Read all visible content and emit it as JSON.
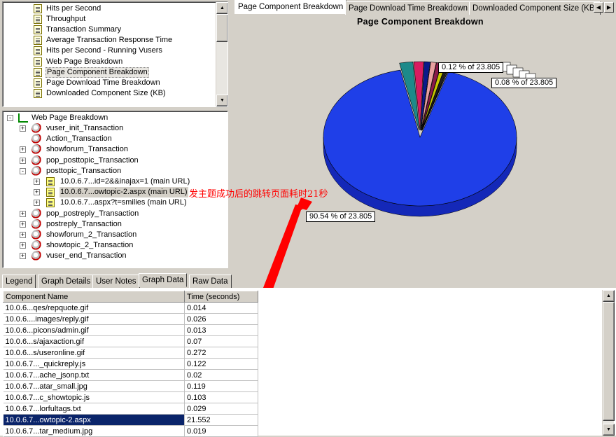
{
  "graph_list": {
    "items": [
      {
        "label": "Hits per Second"
      },
      {
        "label": "Throughput"
      },
      {
        "label": "Transaction Summary"
      },
      {
        "label": "Average Transaction Response Time"
      },
      {
        "label": "Hits per Second - Running Vusers"
      },
      {
        "label": "Web Page Breakdown"
      },
      {
        "label": "Page Component Breakdown",
        "selected": true
      },
      {
        "label": "Page Download Time Breakdown"
      },
      {
        "label": "Downloaded Component Size (KB)"
      }
    ]
  },
  "tree": {
    "root": "Web Page Breakdown",
    "nodes": [
      {
        "label": "vuser_init_Transaction",
        "level": 1,
        "expander": "+",
        "icon": "script"
      },
      {
        "label": "Action_Transaction",
        "level": 1,
        "expander": "",
        "icon": "script"
      },
      {
        "label": "showforum_Transaction",
        "level": 1,
        "expander": "+",
        "icon": "script"
      },
      {
        "label": "pop_posttopic_Transaction",
        "level": 1,
        "expander": "+",
        "icon": "script"
      },
      {
        "label": "posttopic_Transaction",
        "level": 1,
        "expander": "-",
        "icon": "script"
      },
      {
        "label": "10.0.6.7...id=2&&inajax=1 (main URL)",
        "level": 2,
        "expander": "+",
        "icon": "page"
      },
      {
        "label": "10.0.6.7...owtopic-2.aspx (main URL)",
        "level": 2,
        "expander": "+",
        "icon": "page",
        "selected": true
      },
      {
        "label": "10.0.6.7...aspx?t=smilies (main URL)",
        "level": 2,
        "expander": "+",
        "icon": "page"
      },
      {
        "label": "pop_postreply_Transaction",
        "level": 1,
        "expander": "+",
        "icon": "script"
      },
      {
        "label": "postreply_Transaction",
        "level": 1,
        "expander": "+",
        "icon": "script"
      },
      {
        "label": "showforum_2_Transaction",
        "level": 1,
        "expander": "+",
        "icon": "script"
      },
      {
        "label": "showtopic_2_Transaction",
        "level": 1,
        "expander": "+",
        "icon": "script"
      },
      {
        "label": "vuser_end_Transaction",
        "level": 1,
        "expander": "+",
        "icon": "script"
      }
    ]
  },
  "annotation": {
    "text": "发主题成功后的跳转页面耗时21秒",
    "color": "#ff0000"
  },
  "graph_tabs": [
    {
      "label": "Page Component Breakdown",
      "active": true
    },
    {
      "label": "Page Download Time Breakdown"
    },
    {
      "label": "Downloaded Component Size (KB)"
    }
  ],
  "bottom_tabs": [
    {
      "label": "Legend"
    },
    {
      "label": "Graph Details"
    },
    {
      "label": "User Notes"
    },
    {
      "label": "Graph Data",
      "active": true
    },
    {
      "label": "Raw Data"
    }
  ],
  "table": {
    "headers": [
      "Component Name",
      "Time (seconds)"
    ],
    "rows": [
      [
        "10.0.6...qes/repquote.gif",
        "0.014"
      ],
      [
        "10.0.6....images/reply.gif",
        "0.026"
      ],
      [
        "10.0.6...picons/admin.gif",
        "0.013"
      ],
      [
        "10.0.6...s/ajaxaction.gif",
        "0.07"
      ],
      [
        "10.0.6...s/useronline.gif",
        "0.272"
      ],
      [
        "10.0.6.7..._quickreply.js",
        "0.122"
      ],
      [
        "10.0.6.7...ache_jsonp.txt",
        "0.02"
      ],
      [
        "10.0.6.7...atar_small.jpg",
        "0.119"
      ],
      [
        "10.0.6.7...c_showtopic.js",
        "0.103"
      ],
      [
        "10.0.6.7...lorfultags.txt",
        "0.029"
      ],
      [
        "10.0.6.7...owtopic-2.aspx",
        "21.552"
      ],
      [
        "10.0.6.7...tar_medium.jpg",
        "0.019"
      ]
    ],
    "selected_row": 10
  },
  "chart_data": {
    "type": "pie",
    "title": "Page Component Breakdown",
    "total": 23.805,
    "labels_shown": [
      "0.12 % of 23.805",
      "0.08 % of 23.805",
      "90.54 % of 23.805"
    ],
    "slices": [
      {
        "value": 90.54,
        "color": "#1f3fe8",
        "label": "90.54 % of 23.805"
      },
      {
        "value": 2.2,
        "color": "#1d8a8a"
      },
      {
        "value": 1.6,
        "color": "#d81b60"
      },
      {
        "value": 1.0,
        "color": "#0a1a8a"
      },
      {
        "value": 0.9,
        "color": "#e8a0a0"
      },
      {
        "value": 0.8,
        "color": "#8a1a4a"
      },
      {
        "value": 0.7,
        "color": "#c8c800"
      },
      {
        "value": 0.5,
        "color": "#202020"
      },
      {
        "value": 0.12,
        "color": "#ffffff",
        "label": "0.12 % of 23.805"
      },
      {
        "value": 0.08,
        "color": "#ffffff",
        "label": "0.08 % of 23.805"
      }
    ]
  }
}
